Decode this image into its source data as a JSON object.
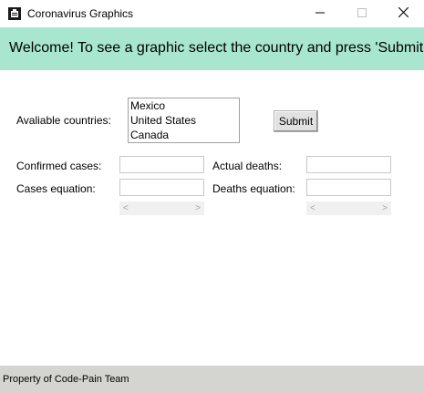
{
  "window": {
    "title": "Coronavirus Graphics",
    "app_icon": "app-window-icon",
    "controls": [
      "minimize-icon",
      "maximize-icon",
      "close-icon"
    ]
  },
  "banner": {
    "text": "Welcome! To see a graphic select the country and press 'Submit'.",
    "color": "#a8e6cf"
  },
  "form": {
    "countries_label": "Avaliable countries:",
    "countries": [
      "Mexico",
      "United States",
      "Canada"
    ],
    "submit_label": "Submit",
    "confirmed_cases_label": "Confirmed cases:",
    "confirmed_cases_value": "",
    "actual_deaths_label": "Actual deaths:",
    "actual_deaths_value": "",
    "cases_equation_label": "Cases equation:",
    "cases_equation_value": "",
    "deaths_equation_label": "Deaths equation:",
    "deaths_equation_value": ""
  },
  "statusbar": {
    "text": "Property of Code-Pain Team",
    "color": "#d4d4d0"
  }
}
